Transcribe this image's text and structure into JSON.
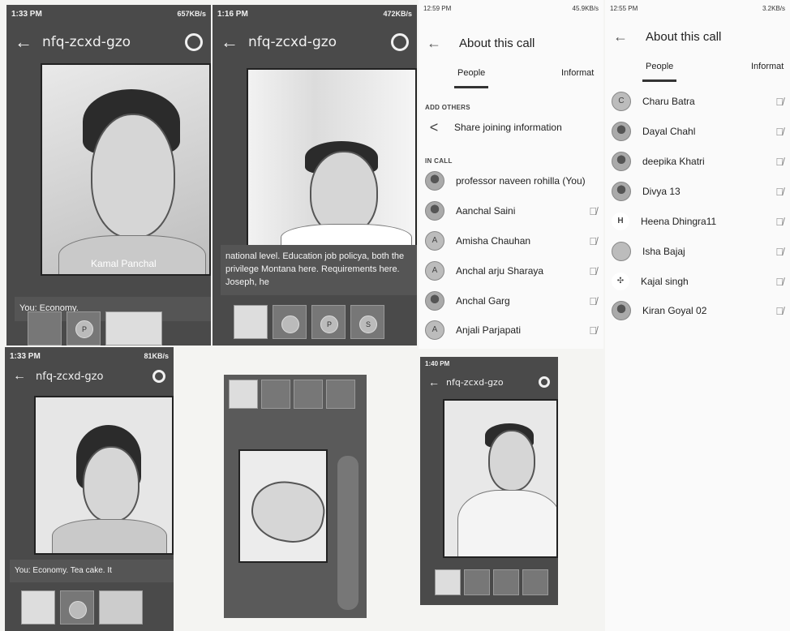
{
  "panel1": {
    "status_time": "1:33 PM",
    "status_right": "657KB/s",
    "title": "nfq-zcxd-gzo",
    "tile_name": "Kamal Panchal",
    "caption": "You: Economy."
  },
  "panel2": {
    "status_time": "1:16 PM",
    "status_right": "472KB/s",
    "title": "nfq-zcxd-gzo",
    "caption": "national level. Education job policya, both the privilege Montana here. Requirements here. Joseph, he"
  },
  "panel3": {
    "status_time": "1:33 PM",
    "status_right": "81KB/s",
    "title": "nfq-zcxd-gzo",
    "caption": "You: Economy. Tea cake. It"
  },
  "panel6": {
    "status_time": "1:40 PM",
    "title": "nfq-zcxd-gzo"
  },
  "about1": {
    "status_time": "12:59 PM",
    "status_right": "45.9KB/s",
    "title": "About this call",
    "tabs": [
      "People",
      "Informat"
    ],
    "add_others": "ADD OTHERS",
    "share": "Share joining information",
    "in_call": "IN CALL",
    "people": [
      {
        "name": "professor naveen rohilla (You)"
      },
      {
        "name": "Aanchal Saini"
      },
      {
        "name": "Amisha Chauhan",
        "initial": "A"
      },
      {
        "name": "Anchal arju Sharaya",
        "initial": "A"
      },
      {
        "name": "Anchal Garg"
      },
      {
        "name": "Anjali Parjapati",
        "initial": "A"
      }
    ]
  },
  "about2": {
    "status_time": "12:55 PM",
    "status_right": "3.2KB/s",
    "title": "About this call",
    "tabs": [
      "People",
      "Informat"
    ],
    "people": [
      {
        "name": "Charu Batra",
        "initial": "C"
      },
      {
        "name": "Dayal Chahl"
      },
      {
        "name": "deepika Khatri"
      },
      {
        "name": "Divya 13"
      },
      {
        "name": "Heena Dhingra11"
      },
      {
        "name": "Isha Bajaj"
      },
      {
        "name": "Kajal singh"
      },
      {
        "name": "Kiran Goyal 02"
      }
    ]
  },
  "icons": {
    "mic_off": "mic-off-icon",
    "share": "share-icon",
    "back": "arrow-back-icon",
    "rotate": "switch-camera-icon"
  }
}
